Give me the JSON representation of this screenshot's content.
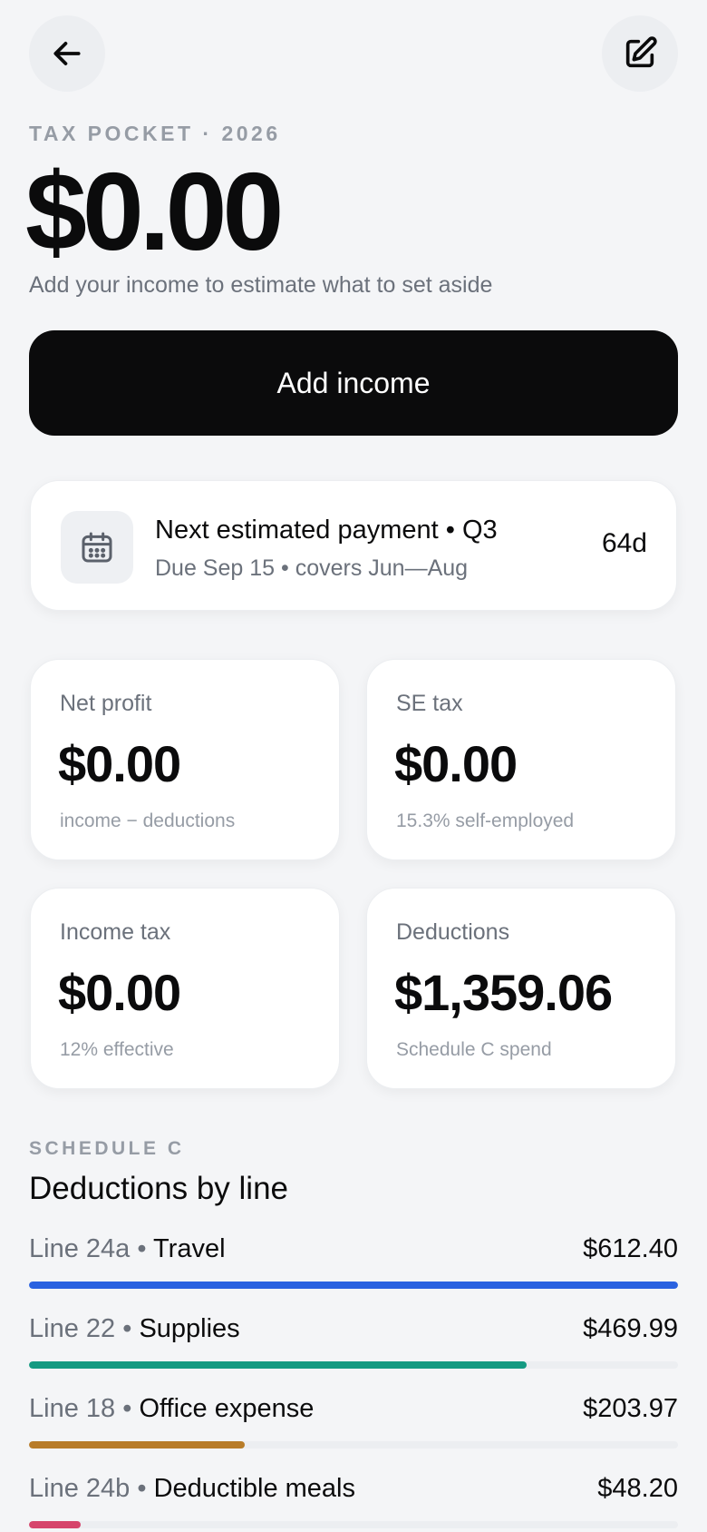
{
  "header": {
    "back_icon": "arrow-left-icon",
    "edit_icon": "edit-square-icon",
    "pocket_label": "TAX POCKET · 2026",
    "amount": "$0.00",
    "hint": "Add your income to estimate what to set aside"
  },
  "add_income_label": "Add income",
  "payment": {
    "icon": "calendar-icon",
    "title": "Next estimated payment • Q3",
    "subtitle": "Due Sep 15 • covers Jun—Aug",
    "days": "64d"
  },
  "stats": [
    {
      "label": "Net profit",
      "value": "$0.00",
      "note": "income − deductions"
    },
    {
      "label": "SE tax",
      "value": "$0.00",
      "note": "15.3% self-employed"
    },
    {
      "label": "Income tax",
      "value": "$0.00",
      "note": "12% effective"
    },
    {
      "label": "Deductions",
      "value": "$1,359.06",
      "note": "Schedule C spend"
    }
  ],
  "schedule": {
    "eyebrow": "SCHEDULE C",
    "title": "Deductions by line",
    "lines": [
      {
        "code": "Line 24a",
        "name": "Travel",
        "amount": "$612.40",
        "share": 1.0,
        "color": "#2a62e0"
      },
      {
        "code": "Line 22",
        "name": "Supplies",
        "amount": "$469.99",
        "share": 0.767,
        "color": "#149a82"
      },
      {
        "code": "Line 18",
        "name": "Office expense",
        "amount": "$203.97",
        "share": 0.333,
        "color": "#b87c28"
      },
      {
        "code": "Line 24b",
        "name": "Deductible meals",
        "amount": "$48.20",
        "share": 0.079,
        "color": "#d6456c"
      }
    ]
  }
}
